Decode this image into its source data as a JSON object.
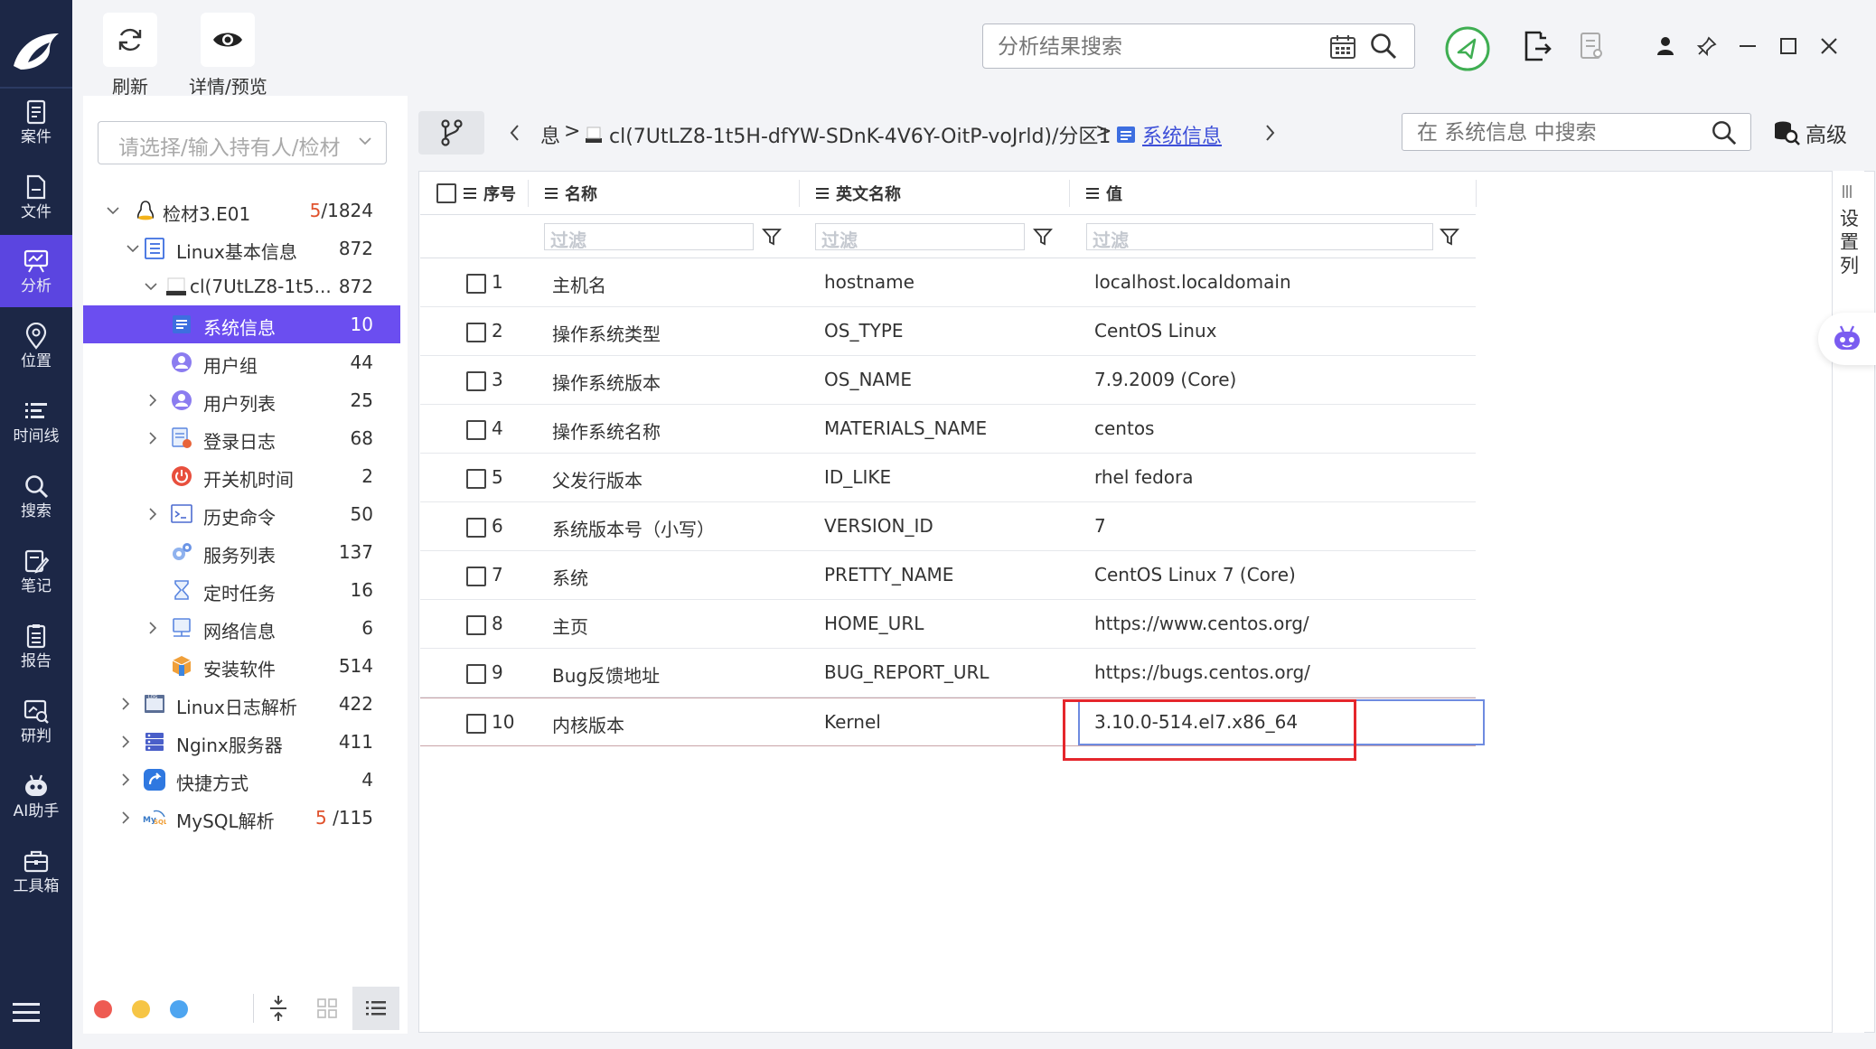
{
  "nav": {
    "items": [
      {
        "label": "案件",
        "icon": "case-icon"
      },
      {
        "label": "文件",
        "icon": "file-icon"
      },
      {
        "label": "分析",
        "icon": "analysis-icon"
      },
      {
        "label": "位置",
        "icon": "location-icon"
      },
      {
        "label": "时间线",
        "icon": "timeline-icon"
      },
      {
        "label": "搜索",
        "icon": "search-icon"
      },
      {
        "label": "笔记",
        "icon": "note-icon"
      },
      {
        "label": "报告",
        "icon": "report-icon"
      },
      {
        "label": "研判",
        "icon": "judge-icon"
      },
      {
        "label": "AI助手",
        "icon": "ai-robot-icon"
      },
      {
        "label": "工具箱",
        "icon": "toolbox-icon"
      }
    ],
    "active_label": "分析"
  },
  "toolbar": {
    "refresh_label": "刷新",
    "detail_label": "详情/预览",
    "search_placeholder": "分析结果搜索"
  },
  "tree": {
    "holder_placeholder": "请选择/输入持有人/检材",
    "nodes": [
      {
        "label": "检材3.E01",
        "count_red": "5",
        "count": "/1824",
        "icon": "linux-penguin-icon"
      },
      {
        "label": "Linux基本信息",
        "count_red": "",
        "count": "872",
        "icon": "list-doc-icon"
      },
      {
        "label": "cl(7UtLZ8-1t5...",
        "count_red": "",
        "count": "872",
        "icon": "drive-icon"
      },
      {
        "label": "系统信息",
        "count_red": "",
        "count": "10",
        "icon": "sysinfo-icon"
      },
      {
        "label": "用户组",
        "count_red": "",
        "count": "44",
        "icon": "user-group-icon"
      },
      {
        "label": "用户列表",
        "count_red": "",
        "count": "25",
        "icon": "user-list-icon"
      },
      {
        "label": "登录日志",
        "count_red": "",
        "count": "68",
        "icon": "login-log-icon"
      },
      {
        "label": "开关机时间",
        "count_red": "",
        "count": "2",
        "icon": "power-icon"
      },
      {
        "label": "历史命令",
        "count_red": "",
        "count": "50",
        "icon": "terminal-icon"
      },
      {
        "label": "服务列表",
        "count_red": "",
        "count": "137",
        "icon": "service-gear-icon"
      },
      {
        "label": "定时任务",
        "count_red": "",
        "count": "16",
        "icon": "hourglass-icon"
      },
      {
        "label": "网络信息",
        "count_red": "",
        "count": "6",
        "icon": "network-icon"
      },
      {
        "label": "安装软件",
        "count_red": "",
        "count": "514",
        "icon": "package-icon"
      },
      {
        "label": "Linux日志解析",
        "count_red": "",
        "count": "422",
        "icon": "log-icon"
      },
      {
        "label": "Nginx服务器",
        "count_red": "",
        "count": "411",
        "icon": "server-icon"
      },
      {
        "label": "快捷方式",
        "count_red": "",
        "count": "4",
        "icon": "shortcut-icon"
      },
      {
        "label": "MySQL解析",
        "count_red": "5",
        "count": " /115",
        "icon": "mysql-icon"
      }
    ]
  },
  "breadcrumb": {
    "items": [
      "息",
      "cl(7UtLZ8-1t5H-dfYW-SDnK-4V6Y-OitP-voJrld)/分区1",
      "系统信息"
    ],
    "separator": ">"
  },
  "sub_search": {
    "placeholder": "在 系统信息 中搜索"
  },
  "advanced_label": "高级",
  "column_settings_label": "设\n置\n列",
  "table": {
    "headers": [
      "序号",
      "名称",
      "英文名称",
      "值"
    ],
    "filter_placeholder": "过滤",
    "rows": [
      [
        "1",
        "主机名",
        "hostname",
        "localhost.localdomain"
      ],
      [
        "2",
        "操作系统类型",
        "OS_TYPE",
        "CentOS Linux"
      ],
      [
        "3",
        "操作系统版本",
        "OS_NAME",
        "7.9.2009 (Core)"
      ],
      [
        "4",
        "操作系统名称",
        "MATERIALS_NAME",
        "centos"
      ],
      [
        "5",
        "父发行版本",
        "ID_LIKE",
        "rhel fedora"
      ],
      [
        "6",
        "系统版本号（小写）",
        "VERSION_ID",
        "7"
      ],
      [
        "7",
        "系统",
        "PRETTY_NAME",
        "CentOS Linux 7 (Core)"
      ],
      [
        "8",
        "主页",
        "HOME_URL",
        "https://www.centos.org/"
      ],
      [
        "9",
        "Bug反馈地址",
        "BUG_REPORT_URL",
        "https://bugs.centos.org/"
      ],
      [
        "10",
        "内核版本",
        "Kernel",
        "3.10.0-514.el7.x86_64"
      ]
    ]
  },
  "colors": {
    "nav_bg": "#1c2746",
    "accent": "#6b4ef0",
    "highlight_red": "#e5262c",
    "count_red": "#e0522d"
  }
}
